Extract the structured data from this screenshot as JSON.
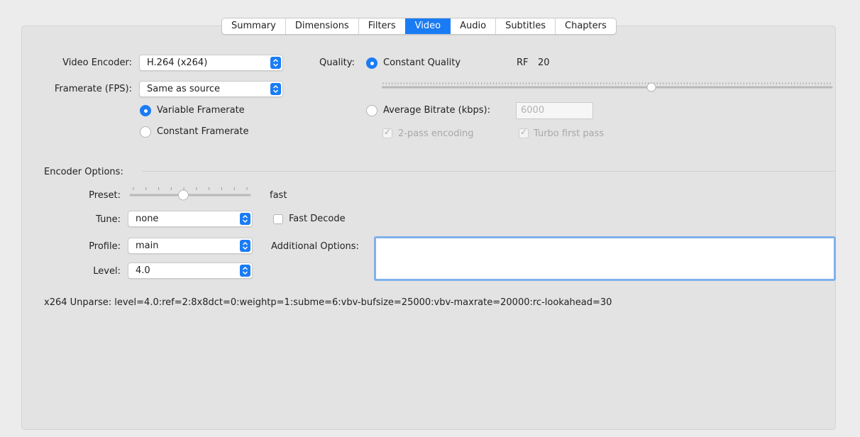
{
  "tabs": [
    "Summary",
    "Dimensions",
    "Filters",
    "Video",
    "Audio",
    "Subtitles",
    "Chapters"
  ],
  "active_tab": "Video",
  "video": {
    "encoder_label": "Video Encoder:",
    "encoder_value": "H.264 (x264)",
    "framerate_label": "Framerate (FPS):",
    "framerate_value": "Same as source",
    "variable_framerate": "Variable Framerate",
    "constant_framerate": "Constant Framerate",
    "quality_label": "Quality:",
    "constant_quality": "Constant Quality",
    "rf_label": "RF",
    "rf_value": "20",
    "average_bitrate": "Average Bitrate (kbps):",
    "bitrate_value": "6000",
    "two_pass": "2-pass encoding",
    "turbo_first_pass": "Turbo first pass"
  },
  "encoder_options": {
    "header": "Encoder Options:",
    "preset_label": "Preset:",
    "preset_value": "fast",
    "tune_label": "Tune:",
    "tune_value": "none",
    "fast_decode": "Fast Decode",
    "profile_label": "Profile:",
    "profile_value": "main",
    "level_label": "Level:",
    "level_value": "4.0",
    "additional_options_label": "Additional Options:",
    "additional_options_value": ""
  },
  "unparse": "x264 Unparse: level=4.0:ref=2:8x8dct=0:weightp=1:subme=6:vbv-bufsize=25000:vbv-maxrate=20000:rc-lookahead=30",
  "quality_slider_fraction": 0.6,
  "preset_slider_fraction": 0.44,
  "colors": {
    "accent": "#1a7cf5",
    "panel": "#e3e3e3",
    "window": "#ececec"
  }
}
